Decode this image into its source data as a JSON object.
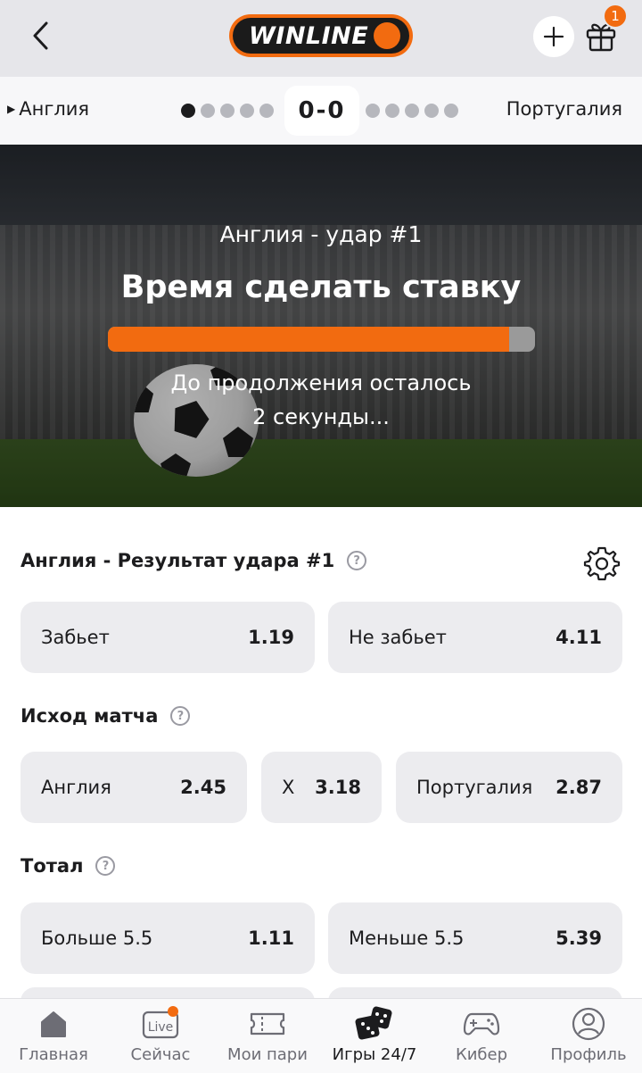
{
  "header": {
    "logo_text": "WINLINE",
    "gift_badge": "1",
    "accent_color": "#f26b10",
    "icons": [
      "back-arrow-icon",
      "plus-icon",
      "gift-icon"
    ]
  },
  "scoreboard": {
    "home_team": "Англия",
    "away_team": "Португалия",
    "score": "0-0",
    "home_kicks": 5,
    "home_kicks_taken": 1,
    "away_kicks": 5
  },
  "hero": {
    "subtitle": "Англия - удар #1",
    "title": "Время сделать ставку",
    "progress_fraction": 0.94,
    "note_line1": "До продолжения осталось",
    "note_line2": "2 секунды..."
  },
  "markets": [
    {
      "title": "Англия - Результат удара #1",
      "help": "?",
      "options": [
        {
          "label": "Забьет",
          "odds": "1.19"
        },
        {
          "label": "Не забьет",
          "odds": "4.11"
        }
      ]
    },
    {
      "title": "Исход матча",
      "help": "?",
      "options": [
        {
          "label": "Англия",
          "odds": "2.45"
        },
        {
          "label": "X",
          "odds": "3.18"
        },
        {
          "label": "Португалия",
          "odds": "2.87"
        }
      ]
    },
    {
      "title": "Тотал",
      "help": "?",
      "options": [
        {
          "label": "Больше 5.5",
          "odds": "1.11"
        },
        {
          "label": "Меньше 5.5",
          "odds": "5.39"
        }
      ]
    }
  ],
  "tabbar": {
    "tabs": [
      {
        "label": "Главная",
        "icon": "home-icon"
      },
      {
        "label": "Сейчас",
        "icon": "live-icon",
        "icon_text": "Live"
      },
      {
        "label": "Мои пари",
        "icon": "ticket-icon"
      },
      {
        "label": "Игры 24/7",
        "icon": "dice-icon",
        "active": true
      },
      {
        "label": "Кибер",
        "icon": "gamepad-icon"
      },
      {
        "label": "Профиль",
        "icon": "profile-icon"
      }
    ]
  }
}
